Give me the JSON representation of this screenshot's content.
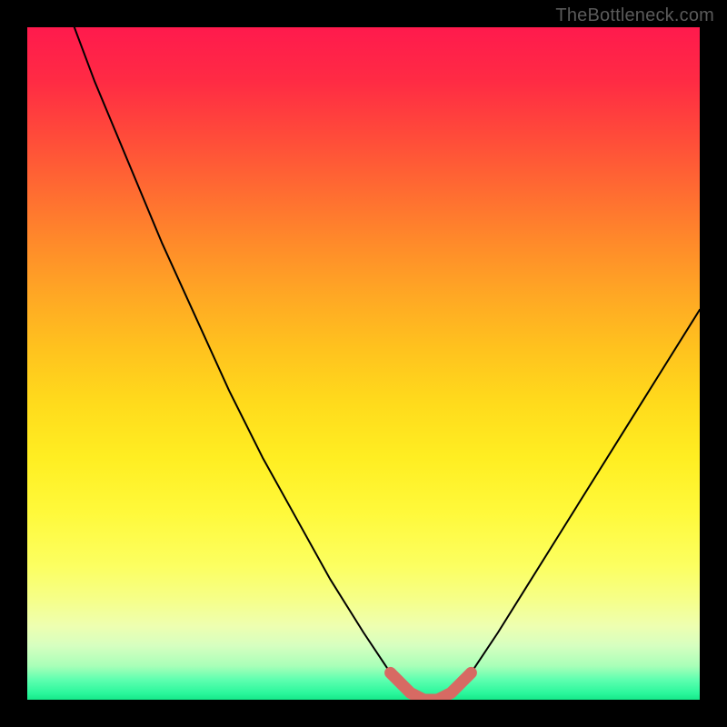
{
  "watermark": {
    "text": "TheBottleneck.com"
  },
  "colors": {
    "curve_stroke": "#000000",
    "highlight_stroke": "#d76a63",
    "background_black": "#000000"
  },
  "chart_data": {
    "type": "line",
    "title": "",
    "xlabel": "",
    "ylabel": "",
    "xlim": [
      0,
      100
    ],
    "ylim": [
      0,
      100
    ],
    "grid": false,
    "series": [
      {
        "name": "bottleneck-curve",
        "x": [
          7,
          10,
          15,
          20,
          25,
          30,
          35,
          40,
          45,
          50,
          54,
          57,
          59,
          61,
          63,
          66,
          70,
          75,
          80,
          85,
          90,
          95,
          100
        ],
        "y": [
          100,
          92,
          80,
          68,
          57,
          46,
          36,
          27,
          18,
          10,
          4,
          1,
          0,
          0,
          1,
          4,
          10,
          18,
          26,
          34,
          42,
          50,
          58
        ]
      }
    ],
    "annotations": [
      {
        "name": "valley-highlight",
        "x": [
          54,
          57,
          59,
          61,
          63,
          66
        ],
        "y": [
          4,
          1,
          0,
          0,
          1,
          4
        ]
      }
    ]
  }
}
